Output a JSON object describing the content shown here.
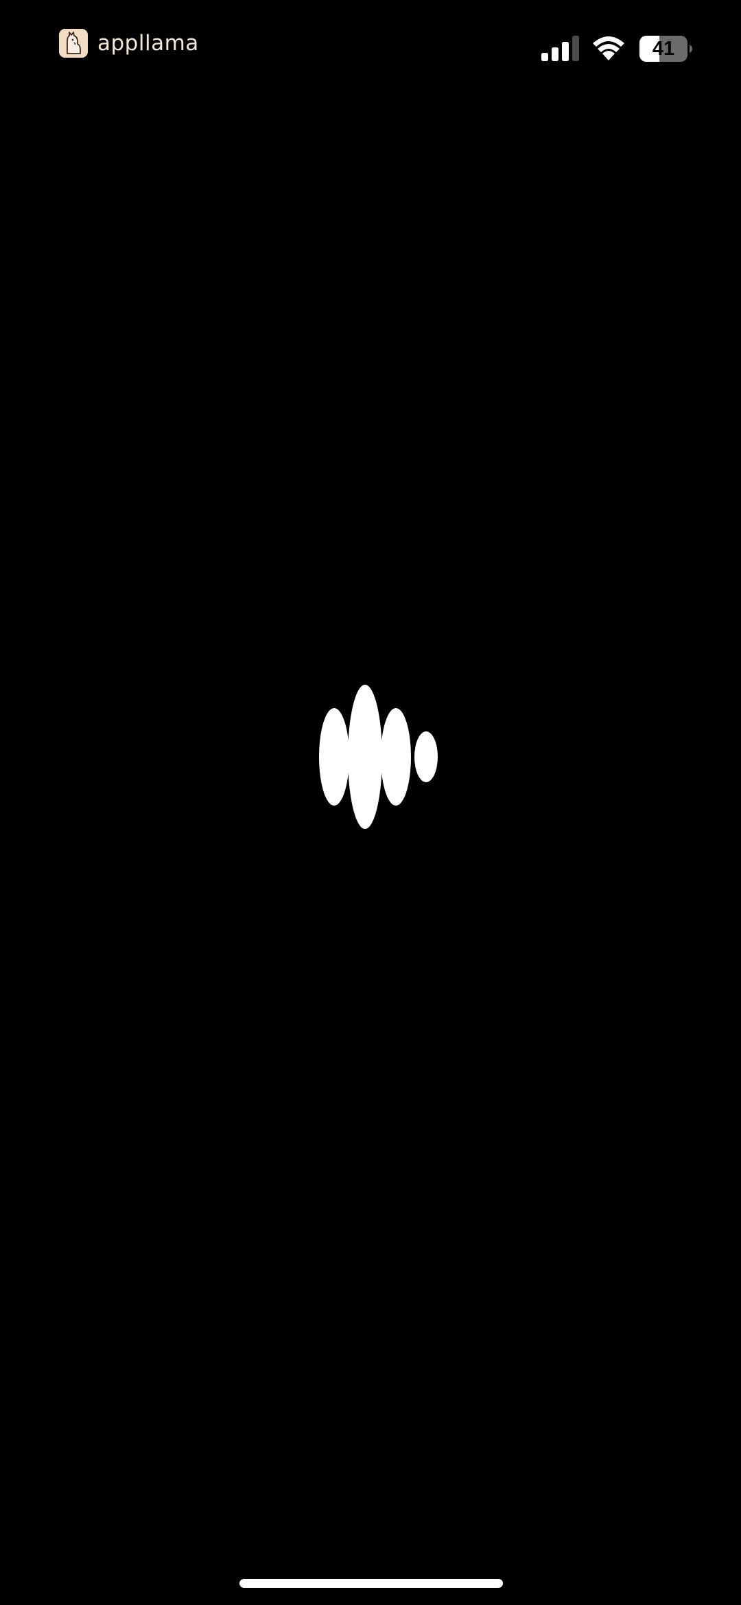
{
  "app": {
    "name": "appllama",
    "logo_icon": "llama-logo-icon"
  },
  "status_bar": {
    "battery_percent": "41",
    "signal_icon": "cellular-signal-icon",
    "wifi_icon": "wifi-icon",
    "battery_icon": "battery-icon"
  },
  "main": {
    "voice_indicator_icon": "voice-waveform-icon"
  },
  "colors": {
    "background": "#000000",
    "foreground": "#ffffff",
    "brand_text": "#f4e6d8",
    "logo_background": "#f3dcc4"
  }
}
